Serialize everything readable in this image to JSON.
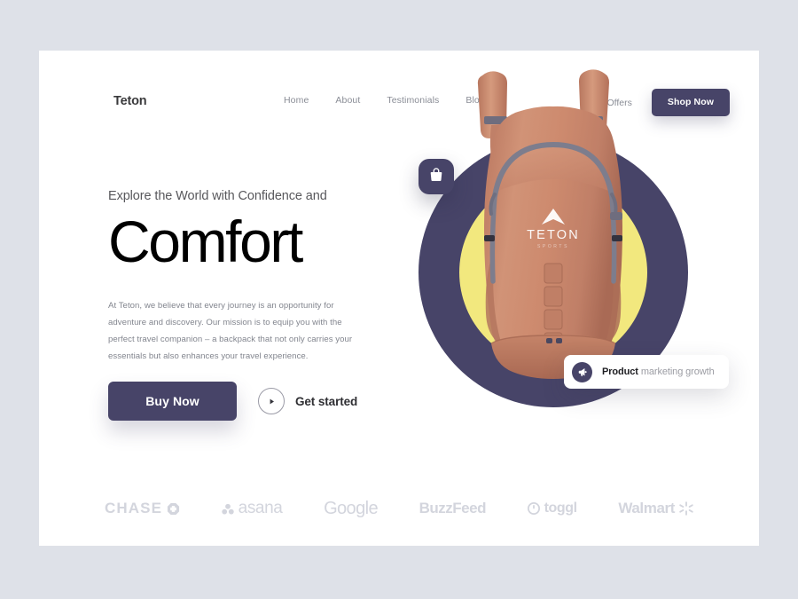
{
  "theme": {
    "page_background": "#dee1e8",
    "card_background": "#ffffff",
    "accent_navy": "#474468",
    "accent_yellow": "#f2e87e",
    "backpack_color": "#c9846a",
    "muted_text": "#8a8d96",
    "logo_gray": "#d3d5dd"
  },
  "nav": {
    "brand": "Teton",
    "links": [
      {
        "label": "Home"
      },
      {
        "label": "About"
      },
      {
        "label": "Testimonials"
      },
      {
        "label": "Blogs"
      }
    ],
    "offers_label": "Offers",
    "shop_now_label": "Shop Now"
  },
  "hero": {
    "eyebrow": "Explore the World with Confidence and",
    "headline": "Comfort",
    "paragraph": "At Teton, we believe that every journey is an opportunity for adventure and discovery. Our mission is to equip you with the perfect travel companion – a backpack that not only carries your essentials but also enhances your travel experience.",
    "primary_cta": "Buy Now",
    "secondary_cta": "Get started"
  },
  "visual": {
    "bag_badge_icon": "shopping-bag-icon",
    "product_card": {
      "icon": "megaphone-icon",
      "bold_text": "Product",
      "rest_text": " marketing growth"
    },
    "backpack": {
      "brand_mark": "TETON",
      "brand_sub": "SPORTS"
    }
  },
  "logos": [
    {
      "name": "chase",
      "label": "CHASE"
    },
    {
      "name": "asana",
      "label": "asana"
    },
    {
      "name": "google",
      "label": "Google"
    },
    {
      "name": "buzzfeed",
      "label": "BuzzFeed"
    },
    {
      "name": "toggl",
      "label": "toggl"
    },
    {
      "name": "walmart",
      "label": "Walmart"
    }
  ]
}
